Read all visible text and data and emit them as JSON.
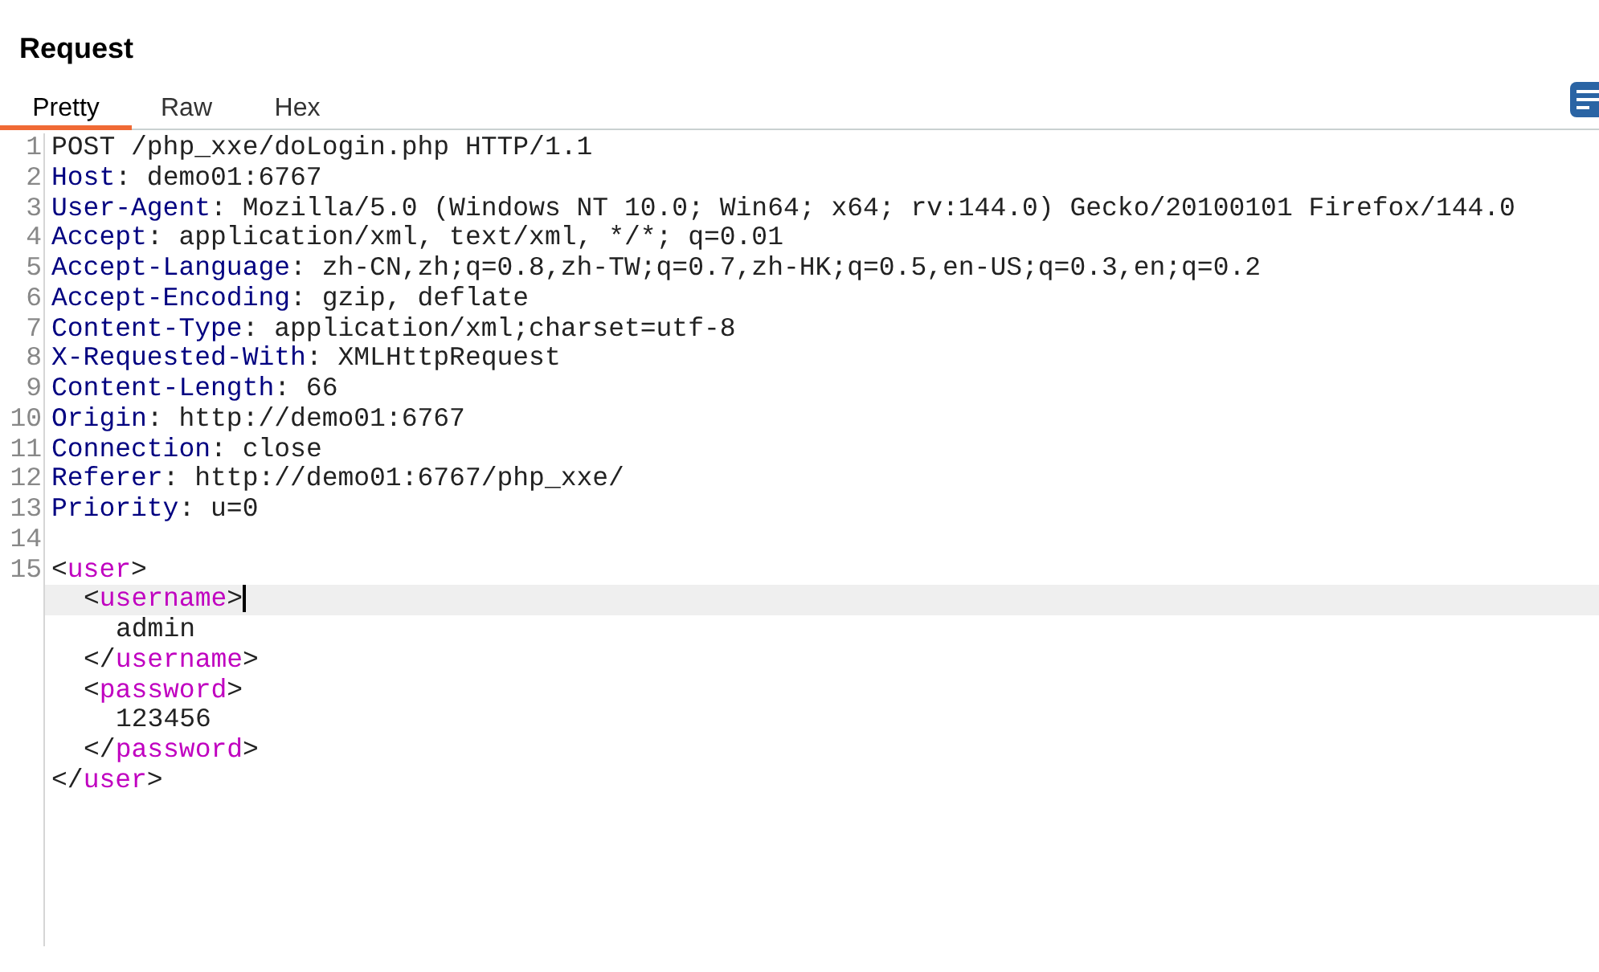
{
  "title": "Request",
  "tabs": [
    {
      "label": "Pretty",
      "selected": true
    },
    {
      "label": "Raw",
      "selected": false
    },
    {
      "label": "Hex",
      "selected": false
    }
  ],
  "lines": [
    {
      "number": "1",
      "segments": [
        {
          "kind": "text",
          "text": "POST /php_xxe/doLogin.php HTTP/1.1"
        }
      ]
    },
    {
      "number": "2",
      "segments": [
        {
          "kind": "key",
          "text": "Host"
        },
        {
          "kind": "text",
          "text": ": demo01:6767"
        }
      ]
    },
    {
      "number": "3",
      "segments": [
        {
          "kind": "key",
          "text": "User-Agent"
        },
        {
          "kind": "text",
          "text": ": Mozilla/5.0 (Windows NT 10.0; Win64; x64; rv:144.0) Gecko/20100101 Firefox/144.0"
        }
      ]
    },
    {
      "number": "4",
      "segments": [
        {
          "kind": "key",
          "text": "Accept"
        },
        {
          "kind": "text",
          "text": ": application/xml, text/xml, */*; q=0.01"
        }
      ]
    },
    {
      "number": "5",
      "segments": [
        {
          "kind": "key",
          "text": "Accept-Language"
        },
        {
          "kind": "text",
          "text": ": zh-CN,zh;q=0.8,zh-TW;q=0.7,zh-HK;q=0.5,en-US;q=0.3,en;q=0.2"
        }
      ]
    },
    {
      "number": "6",
      "segments": [
        {
          "kind": "key",
          "text": "Accept-Encoding"
        },
        {
          "kind": "text",
          "text": ": gzip, deflate"
        }
      ]
    },
    {
      "number": "7",
      "segments": [
        {
          "kind": "key",
          "text": "Content-Type"
        },
        {
          "kind": "text",
          "text": ": application/xml;charset=utf-8"
        }
      ]
    },
    {
      "number": "8",
      "segments": [
        {
          "kind": "key",
          "text": "X-Requested-With"
        },
        {
          "kind": "text",
          "text": ": XMLHttpRequest"
        }
      ]
    },
    {
      "number": "9",
      "segments": [
        {
          "kind": "key",
          "text": "Content-Length"
        },
        {
          "kind": "text",
          "text": ": 66"
        }
      ]
    },
    {
      "number": "10",
      "segments": [
        {
          "kind": "key",
          "text": "Origin"
        },
        {
          "kind": "text",
          "text": ": http://demo01:6767"
        }
      ]
    },
    {
      "number": "11",
      "segments": [
        {
          "kind": "key",
          "text": "Connection"
        },
        {
          "kind": "text",
          "text": ": close"
        }
      ]
    },
    {
      "number": "12",
      "segments": [
        {
          "kind": "key",
          "text": "Referer"
        },
        {
          "kind": "text",
          "text": ": http://demo01:6767/php_xxe/"
        }
      ]
    },
    {
      "number": "13",
      "segments": [
        {
          "kind": "key",
          "text": "Priority"
        },
        {
          "kind": "text",
          "text": ": u=0"
        }
      ]
    },
    {
      "number": "14"
    }
  ],
  "body": {
    "number": "15",
    "nodes": [
      {
        "open_tag": "<user>",
        "close_tag": "</user>",
        "current": false,
        "children": [
          {
            "open_tag": "<username>",
            "close_tag": "</username>",
            "current": true,
            "children": [
              {
                "text": "admin"
              }
            ]
          },
          {
            "open_tag": "<password>",
            "close_tag": "</password>",
            "current": false,
            "children": [
              {
                "text": "123456"
              }
            ]
          }
        ]
      }
    ]
  }
}
